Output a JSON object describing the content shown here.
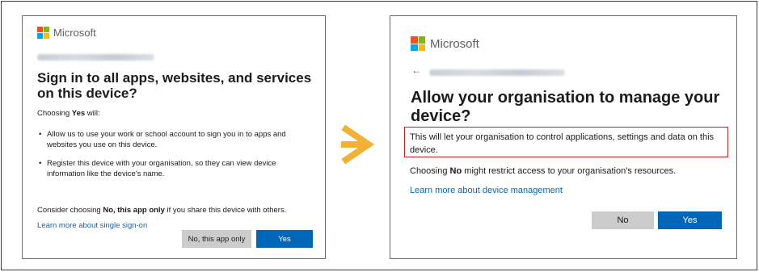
{
  "left_dialog": {
    "brand": "Microsoft",
    "title": "Sign in to all apps, websites, and services on this device?",
    "choosing_prefix": "Choosing ",
    "choosing_bold": "Yes",
    "choosing_suffix": " will:",
    "bullets": [
      "Allow us to use your work or school account to sign you in to apps and websites you use on this device.",
      "Register this device with your organisation, so they can view device information like the device's name."
    ],
    "consider_prefix": "Consider choosing ",
    "consider_bold": "No, this app only",
    "consider_suffix": " if you share this device with others.",
    "learn_more": "Learn more about single sign-on",
    "no_button": "No, this app only",
    "yes_button": "Yes"
  },
  "right_dialog": {
    "brand": "Microsoft",
    "back_arrow": "←",
    "title": "Allow your organisation to manage your device?",
    "warning_text": "This will let your organisation to control applications, settings and data on this device.",
    "choosing_prefix": "Choosing ",
    "choosing_bold": "No",
    "choosing_suffix": " might restrict access to your organisation's resources.",
    "learn_more": "Learn more about device management",
    "no_button": "No",
    "yes_button": "Yes"
  },
  "colors": {
    "primary_button": "#0067b8",
    "secondary_button": "#cccccc",
    "link": "#0067b8",
    "highlight_border": "#c81e1e",
    "arrow": "#f2b134"
  },
  "icons": {
    "logo": "microsoft-logo-icon",
    "arrow": "right-arrow-icon",
    "back": "back-arrow-icon"
  }
}
